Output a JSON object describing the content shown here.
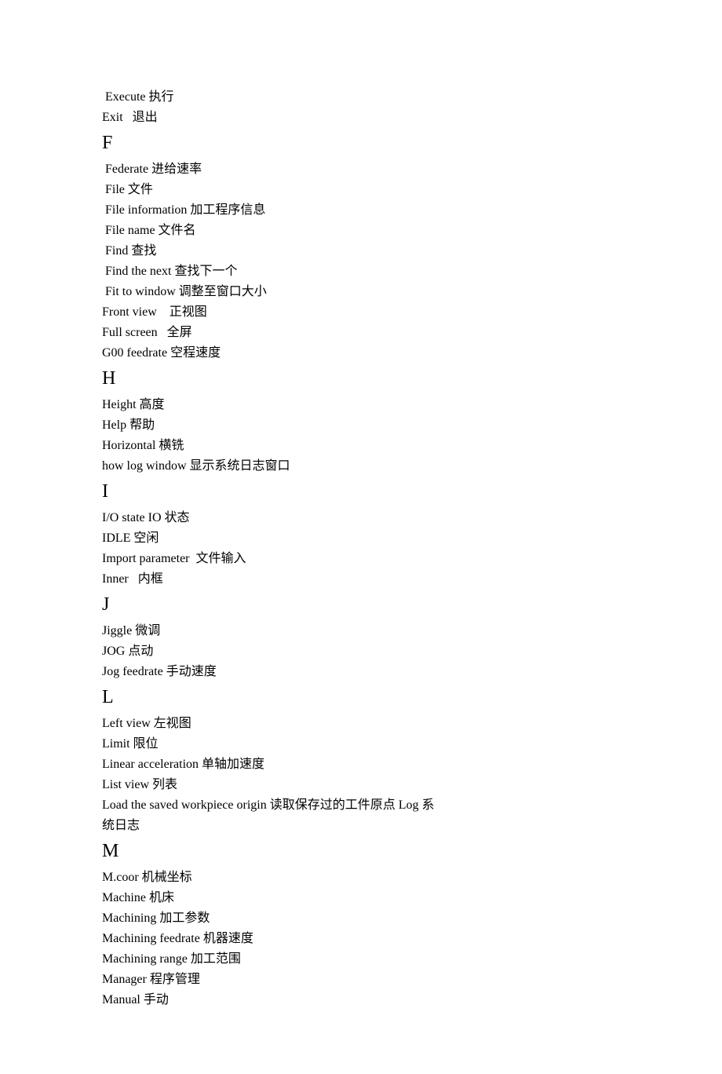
{
  "entries_top": [
    " Execute 执行",
    "Exit   退出"
  ],
  "sections": [
    {
      "letter": "F",
      "entries": [
        " Federate 进给速率",
        " File 文件",
        " File information 加工程序信息",
        " File name 文件名",
        " Find 查找",
        " Find the next 查找下一个",
        " Fit to window 调整至窗口大小",
        "Front view    正视图",
        "Full screen   全屏",
        "",
        "G00 feedrate 空程速度"
      ]
    },
    {
      "letter": "H",
      "entries": [
        "Height 高度",
        "Help 帮助",
        "Horizontal 横铣",
        "how log window 显示系统日志窗口"
      ]
    },
    {
      "letter": "I",
      "entries": [
        "I/O state IO 状态",
        "IDLE 空闲",
        "Import parameter  文件输入",
        "Inner   内框"
      ]
    },
    {
      "letter": "J",
      "entries": [
        "Jiggle 微调",
        "JOG 点动",
        "Jog feedrate 手动速度"
      ]
    },
    {
      "letter": "L",
      "entries": [
        "Left view 左视图",
        "Limit 限位",
        "Linear acceleration 单轴加速度",
        "List view 列表",
        "Load the saved workpiece origin 读取保存过的工件原点 Log 系",
        "统日志"
      ]
    },
    {
      "letter": "M",
      "entries": [
        "M.coor 机械坐标",
        "Machine 机床",
        "Machining 加工参数",
        "Machining feedrate 机器速度",
        "Machining range 加工范围",
        "Manager 程序管理",
        "Manual 手动"
      ]
    }
  ]
}
